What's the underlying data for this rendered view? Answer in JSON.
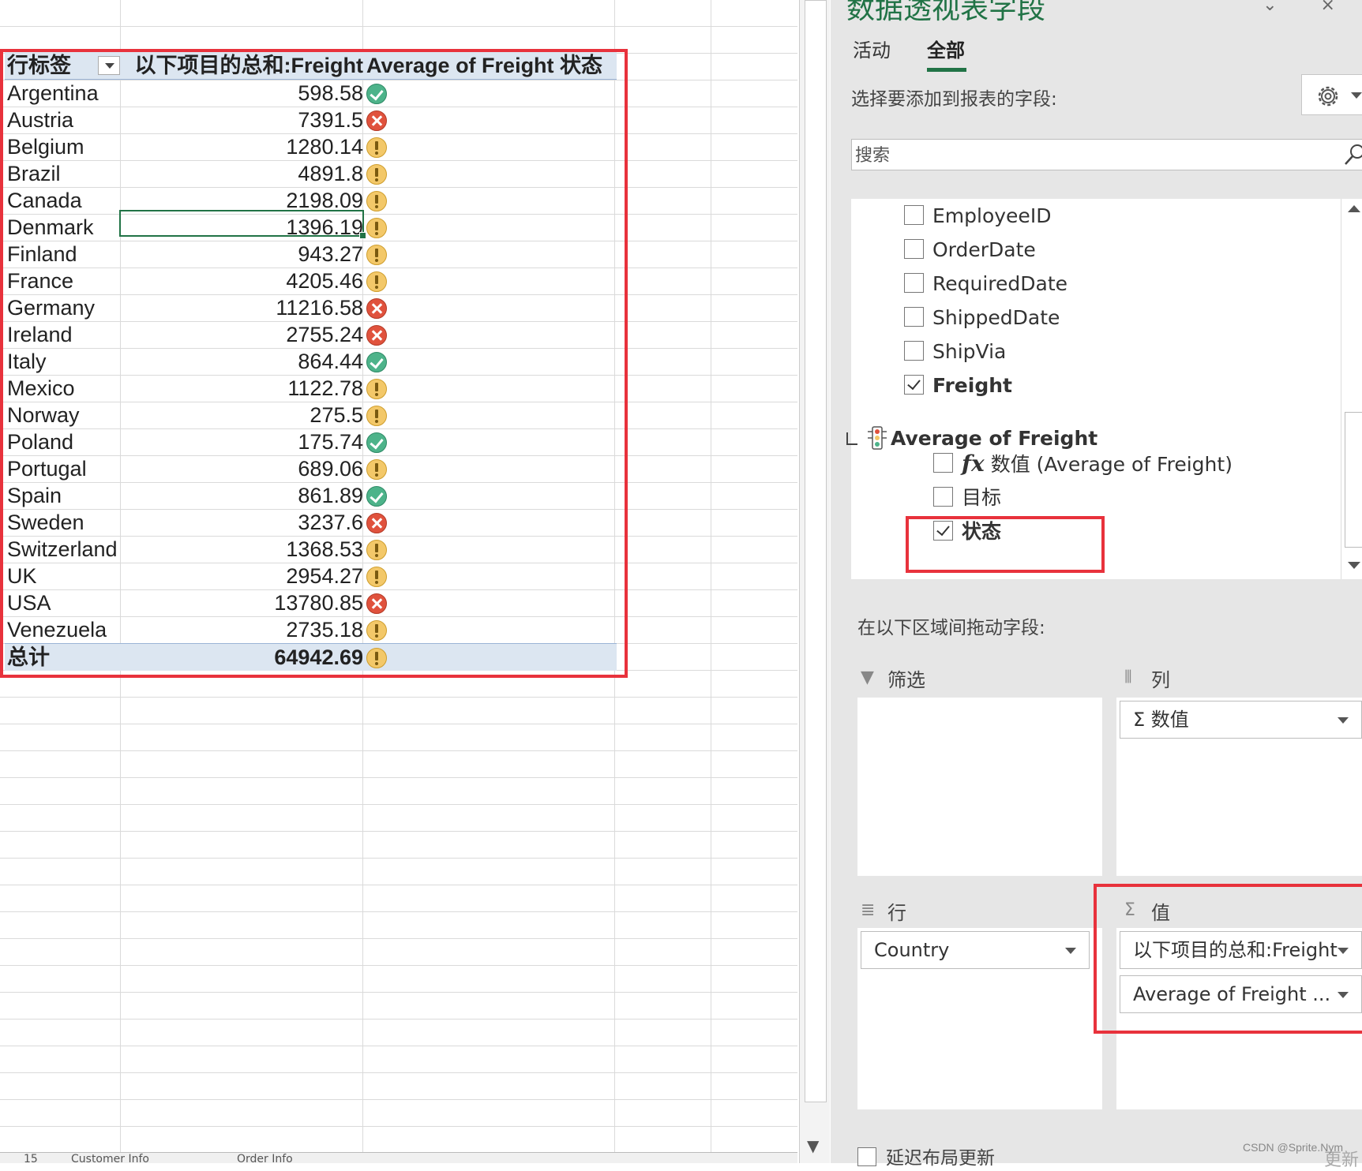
{
  "pivot": {
    "header": {
      "row_label": "行标签",
      "sum_label": "以下项目的总和:Freight",
      "status_label": "Average of Freight 状态"
    },
    "rows": [
      {
        "country": "Argentina",
        "value": "598.58",
        "status": "ok"
      },
      {
        "country": "Austria",
        "value": "7391.5",
        "status": "bad"
      },
      {
        "country": "Belgium",
        "value": "1280.14",
        "status": "warn"
      },
      {
        "country": "Brazil",
        "value": "4891.8",
        "status": "warn"
      },
      {
        "country": "Canada",
        "value": "2198.09",
        "status": "warn"
      },
      {
        "country": "Denmark",
        "value": "1396.19",
        "status": "warn"
      },
      {
        "country": "Finland",
        "value": "943.27",
        "status": "warn"
      },
      {
        "country": "France",
        "value": "4205.46",
        "status": "warn"
      },
      {
        "country": "Germany",
        "value": "11216.58",
        "status": "bad"
      },
      {
        "country": "Ireland",
        "value": "2755.24",
        "status": "bad"
      },
      {
        "country": "Italy",
        "value": "864.44",
        "status": "ok"
      },
      {
        "country": "Mexico",
        "value": "1122.78",
        "status": "warn"
      },
      {
        "country": "Norway",
        "value": "275.5",
        "status": "warn"
      },
      {
        "country": "Poland",
        "value": "175.74",
        "status": "ok"
      },
      {
        "country": "Portugal",
        "value": "689.06",
        "status": "warn"
      },
      {
        "country": "Spain",
        "value": "861.89",
        "status": "ok"
      },
      {
        "country": "Sweden",
        "value": "3237.6",
        "status": "bad"
      },
      {
        "country": "Switzerland",
        "value": "1368.53",
        "status": "warn"
      },
      {
        "country": "UK",
        "value": "2954.27",
        "status": "warn"
      },
      {
        "country": "USA",
        "value": "13780.85",
        "status": "bad"
      },
      {
        "country": "Venezuela",
        "value": "2735.18",
        "status": "warn"
      }
    ],
    "total": {
      "label": "总计",
      "value": "64942.69",
      "status": "warn"
    }
  },
  "sheet_tabs": {
    "tab1": "Customer Info",
    "tab2": "Order Info",
    "indicator": "15"
  },
  "panel": {
    "title": "数据透视表字段",
    "controls": "⌄ ×",
    "tabs": {
      "active_tab": "活动",
      "all_tab": "全部"
    },
    "choose_label": "选择要添加到报表的字段:",
    "search_placeholder": "搜索",
    "fields": [
      {
        "label": "EmployeeID",
        "checked": false
      },
      {
        "label": "OrderDate",
        "checked": false
      },
      {
        "label": "RequiredDate",
        "checked": false
      },
      {
        "label": "ShippedDate",
        "checked": false
      },
      {
        "label": "ShipVia",
        "checked": false
      },
      {
        "label": "Freight",
        "checked": true
      }
    ],
    "kpi": {
      "group": "Average of Freight",
      "fx_symbol": "fx",
      "value_item": "数值 (Average of Freight)",
      "target_item": "目标",
      "status_item": "状态"
    },
    "drag_label": "在以下区域间拖动字段:",
    "areas": {
      "filter": {
        "title": "筛选"
      },
      "columns": {
        "title": "列",
        "chips": [
          "Σ 数值"
        ]
      },
      "rows": {
        "title": "行",
        "chips": [
          "Country"
        ]
      },
      "values": {
        "title": "值",
        "chips": [
          "以下项目的总和:Freight",
          "Average of Freight ..."
        ]
      }
    },
    "defer_label": "延迟布局更新",
    "update_label": "更新"
  },
  "watermark": "CSDN @Sprite.Nym",
  "colors": {
    "excel_green": "#217346",
    "highlight_red": "#e8323c",
    "ok": "#4db38a",
    "bad": "#e0523d",
    "warn": "#f3c869",
    "header_blue": "#dce6f1"
  }
}
